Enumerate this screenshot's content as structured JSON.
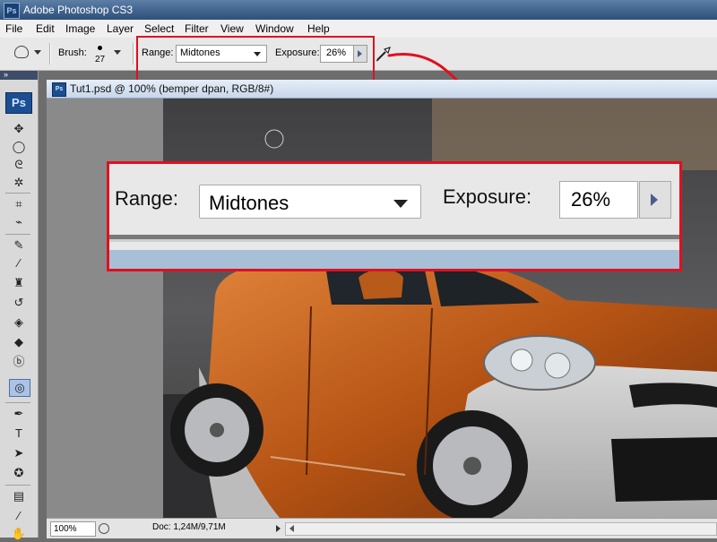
{
  "app": {
    "title": "Adobe Photoshop CS3",
    "icon": "Ps"
  },
  "menu": [
    "File",
    "Edit",
    "Image",
    "Layer",
    "Select",
    "Filter",
    "View",
    "Window",
    "Help"
  ],
  "options_bar": {
    "brush_label": "Brush:",
    "brush_size": "27",
    "range_label": "Range:",
    "range_value": "Midtones",
    "exposure_label": "Exposure:",
    "exposure_value": "26%"
  },
  "toolbox": {
    "logo": "Ps",
    "tools": [
      "move-tool",
      "marquee-tool",
      "lasso-tool",
      "magic-wand-tool",
      "crop-tool",
      "slice-tool",
      "healing-brush-tool",
      "brush-tool",
      "clone-stamp-tool",
      "history-brush-tool",
      "eraser-tool",
      "paint-bucket-tool",
      "blur-tool",
      "dodge-tool",
      "pen-tool",
      "type-tool",
      "path-selection-tool",
      "custom-shape-tool",
      "notes-tool",
      "eyedropper-tool",
      "hand-tool"
    ],
    "active_tool": "dodge-tool"
  },
  "document": {
    "title": "Tut1.psd @ 100% (bemper dpan, RGB/8#)",
    "icon": "Ps",
    "zoom": "100%",
    "doc_info": "Doc: 1,24M/9,71M"
  },
  "callout": {
    "range_label": "Range:",
    "range_value": "Midtones",
    "exposure_label": "Exposure:",
    "exposure_value": "26%"
  },
  "colors": {
    "highlight": "#e01020",
    "title_bar": "#3f628b",
    "car_body": "#c8621a"
  }
}
